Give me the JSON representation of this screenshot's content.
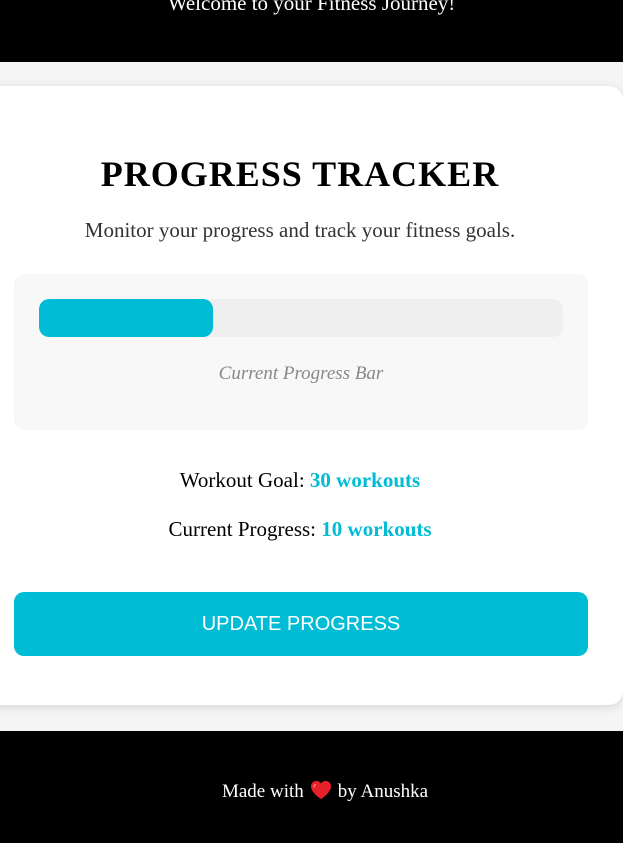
{
  "header": {
    "welcome": "Welcome to your Fitness Journey!"
  },
  "tracker": {
    "title": "PROGRESS TRACKER",
    "subtitle": "Monitor your progress and track your fitness goals.",
    "progress_caption": "Current Progress Bar",
    "progress_fraction": 0.333,
    "goal_label": "Workout Goal:",
    "goal_value": "30 workouts",
    "current_label": "Current Progress:",
    "current_value": "10 workouts",
    "update_button_label": "UPDATE PROGRESS"
  },
  "footer": {
    "made_with": "Made with",
    "heart_icon": "heart-icon",
    "by": "by Anushka"
  },
  "colors": {
    "accent": "#00bcd4",
    "header_bg": "#000000",
    "heart": "#e8202a"
  }
}
